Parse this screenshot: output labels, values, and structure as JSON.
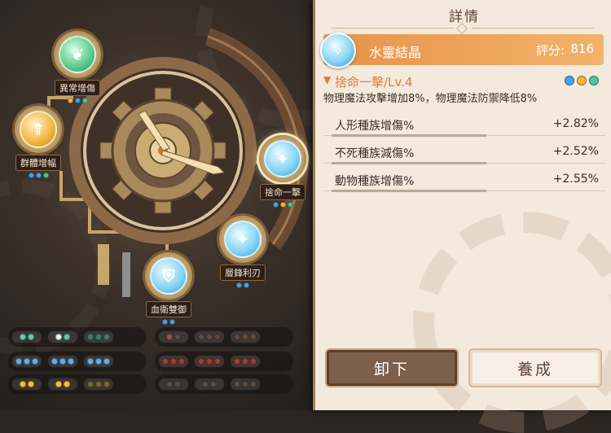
{
  "nodes": [
    {
      "label": "異常增傷",
      "icon": "leaf-emblem-icon",
      "color": "#58c98a",
      "dots": [
        "#f2b43a",
        "#4aa3e2",
        "#4fc6a0"
      ]
    },
    {
      "label": "群體增幅",
      "icon": "arrow-up-emblem-icon",
      "color": "#f2b43a",
      "dots": [
        "#4aa3e2",
        "#4aa3e2",
        "#4fc6a0"
      ]
    },
    {
      "label": "捨命一擊",
      "icon": "crystal-emblem-icon",
      "color": "#7fd2f5",
      "dots": [
        "#4aa3e2",
        "#f2b43a",
        "#4fc6a0"
      ]
    },
    {
      "label": "層鋒利刃",
      "icon": "crystal-emblem-icon",
      "color": "#7fd2f5",
      "dots": [
        "#4aa3e2",
        "#4aa3e2"
      ]
    },
    {
      "label": "血衛雙御",
      "icon": "shield-emblem-icon",
      "color": "#7fd2f5",
      "dots": [
        "#4aa3e2",
        "#4aa3e2"
      ]
    }
  ],
  "slots": {
    "left": [
      [
        {
          "colors": [
            "#5fd0a9",
            "#5fd0a9"
          ]
        },
        {
          "colors": [
            "#e0f9ef",
            "#5fd0a9"
          ]
        },
        {
          "colors": [
            "#3c7f6a",
            "#3c7f6a",
            "#3c7f6a"
          ]
        }
      ],
      [
        {
          "colors": [
            "#5fb0ef",
            "#5fb0ef",
            "#5fb0ef"
          ]
        },
        {
          "colors": [
            "#5fb0ef",
            "#5fb0ef",
            "#5fb0ef"
          ]
        },
        {
          "colors": [
            "#5fb0ef",
            "#5fb0ef",
            "#5fb0ef"
          ]
        }
      ],
      [
        {
          "colors": [
            "#f0c23a",
            "#f0c23a"
          ]
        },
        {
          "colors": [
            "#f0c23a",
            "#f0c23a"
          ]
        },
        {
          "colors": [
            "#7a6530",
            "#7a6530",
            "#7a6530"
          ]
        }
      ]
    ],
    "right": [
      [
        {
          "colors": [
            "#8a5a4a",
            "#5e4a3e"
          ]
        },
        {
          "colors": [
            "#5e4a3e",
            "#5e4a3e",
            "#5e4a3e"
          ]
        },
        {
          "colors": [
            "#5e4a3e",
            "#5e4a3e",
            "#5e4a3e"
          ]
        }
      ],
      [
        {
          "colors": [
            "#a13b3b",
            "#a13b3b",
            "#a13b3b"
          ]
        },
        {
          "colors": [
            "#a13b3b",
            "#a13b3b",
            "#a13b3b"
          ]
        },
        {
          "colors": [
            "#a13b3b",
            "#a13b3b",
            "#a13b3b"
          ]
        }
      ],
      [
        {
          "colors": [
            "#5e4a3e",
            "#5e4a3e"
          ]
        },
        {
          "colors": [
            "#5e4a3e",
            "#5e4a3e"
          ]
        },
        {
          "colors": [
            "#5e4a3e",
            "#5e4a3e",
            "#5e4a3e"
          ]
        }
      ]
    ]
  },
  "panel": {
    "title": "詳情",
    "crystal": {
      "name": "水靈結晶",
      "score_label": "評分:",
      "score": "816",
      "icon": "water-crystal-icon"
    },
    "skill": {
      "name": "捨命一擊/Lv.4",
      "description": "物理魔法攻擊增加8%，物理魔法防禦降低8%",
      "dots": [
        "#4aa3e2",
        "#f2b43a",
        "#4fc6a0"
      ]
    },
    "stats": [
      {
        "name": "人形種族增傷%",
        "value": "+2.82%"
      },
      {
        "name": "不死種族減傷%",
        "value": "+2.52%"
      },
      {
        "name": "動物種族增傷%",
        "value": "+2.55%"
      }
    ],
    "buttons": {
      "unequip": "卸下",
      "upgrade": "養成"
    }
  },
  "colors": {
    "accent": "#e07b3b",
    "panel_bg": "#f3e9dc",
    "header_gradient_start": "#e7924a"
  }
}
